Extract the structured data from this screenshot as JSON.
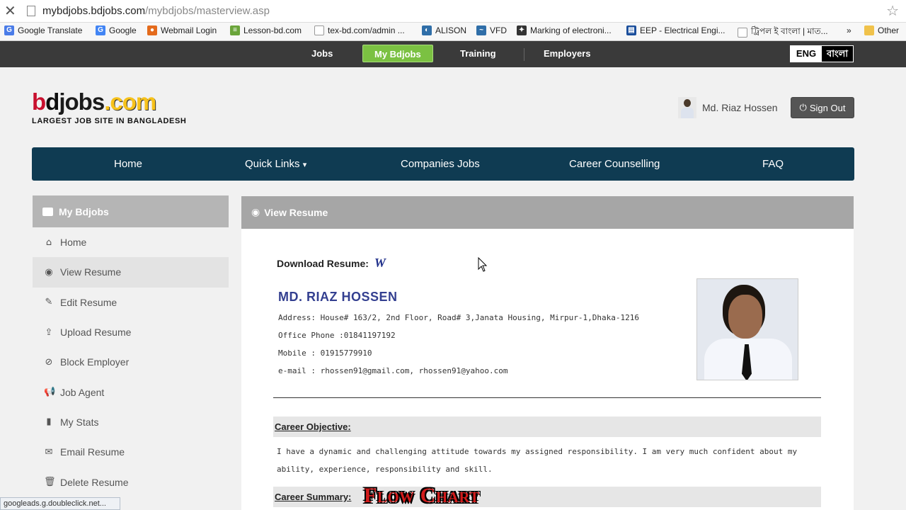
{
  "browser": {
    "close_glyph": "✕",
    "url_host": "mybdjobs.bdjobs.com",
    "url_path": "/mybdjobs/masterview.asp",
    "star_glyph": "☆"
  },
  "bookmarks": [
    {
      "label": "Google Translate",
      "icon": "google-translate-icon",
      "color": "#4a7ce8"
    },
    {
      "label": "Google",
      "icon": "google-icon",
      "color": "#4285f4"
    },
    {
      "label": "Webmail Login",
      "icon": "webmail-icon",
      "color": "#e46b1c"
    },
    {
      "label": "Lesson-bd.com",
      "icon": "lesson-icon",
      "color": "#6aa43a"
    },
    {
      "label": "tex-bd.com/admin ...",
      "icon": "page-icon",
      "color": "#ffffff"
    },
    {
      "label": "ALISON",
      "icon": "globe-icon",
      "color": "#2f6ea8"
    },
    {
      "label": "VFD",
      "icon": "vfd-icon",
      "color": "#2f6ea8"
    },
    {
      "label": "Marking of electroni...",
      "icon": "marking-icon",
      "color": "#333333"
    },
    {
      "label": "EEP - Electrical Engi...",
      "icon": "eep-icon",
      "color": "#1b4f9c"
    },
    {
      "label": "ট্রিপল ই বাংলা | মাত...",
      "icon": "page-icon",
      "color": "#ffffff"
    },
    {
      "label": "»",
      "icon": "more-icon",
      "color": "#ffffff"
    },
    {
      "label": "Other",
      "icon": "folder-icon",
      "color": "#f0c24b"
    }
  ],
  "topnav": {
    "jobs": "Jobs",
    "my_bdjobs": "My Bdjobs",
    "training": "Training",
    "employers": "Employers",
    "lang_eng": "ENG",
    "lang_bn": "বাংলা"
  },
  "header": {
    "logo_b": "b",
    "logo_d": "d",
    "logo_jobs": "jobs",
    "logo_com": ".com",
    "tagline": "LARGEST JOB SITE IN BANGLADESH",
    "user_name": "Md. Riaz Hossen",
    "signout_label": "Sign Out",
    "signout_glyph": "⏻"
  },
  "mainnav": {
    "home": "Home",
    "quick_links": "Quick Links",
    "caret": "▾",
    "companies_jobs": "Companies Jobs",
    "career_counselling": "Career Counselling",
    "faq": "FAQ"
  },
  "sidebar": {
    "title": "My Bdjobs",
    "title_glyph": "💼",
    "items": [
      {
        "label": "Home",
        "glyph": "⌂",
        "icon": "home-icon"
      },
      {
        "label": "View Resume",
        "glyph": "◉",
        "icon": "eye-icon"
      },
      {
        "label": "Edit Resume",
        "glyph": "✎",
        "icon": "edit-icon"
      },
      {
        "label": "Upload Resume",
        "glyph": "⇪",
        "icon": "upload-icon"
      },
      {
        "label": "Block Employer",
        "glyph": "⊘",
        "icon": "block-icon"
      },
      {
        "label": "Job Agent",
        "glyph": "📢",
        "icon": "megaphone-icon"
      },
      {
        "label": "My Stats",
        "glyph": "▮",
        "icon": "stats-icon"
      },
      {
        "label": "Email Resume",
        "glyph": "✉",
        "icon": "envelope-icon"
      },
      {
        "label": "Delete Resume",
        "glyph": "🗑",
        "icon": "trash-icon"
      }
    ]
  },
  "resume": {
    "panel_title": "View Resume",
    "panel_glyph": "◉",
    "download_label": "Download Resume:",
    "download_glyph": "W",
    "name": "MD. RIAZ HOSSEN",
    "address": "Address: House# 163/2, 2nd Floor, Road# 3,Janata Housing, Mirpur-1,Dhaka-1216",
    "office_phone": "Office Phone :01841197192",
    "mobile": "Mobile : 01915779910",
    "email": "e-mail : rhossen91@gmail.com, rhossen91@yahoo.com",
    "career_objective_title": "Career Objective:",
    "career_objective_text": "I have a dynamic and challenging attitude towards my assigned responsibility. I am very much confident about my ability, experience, responsibility and skill.",
    "career_summary_title": "Career Summary:"
  },
  "status_bar": "googleads.g.doubleclick.net...",
  "overlay_text": "Flow Chart"
}
